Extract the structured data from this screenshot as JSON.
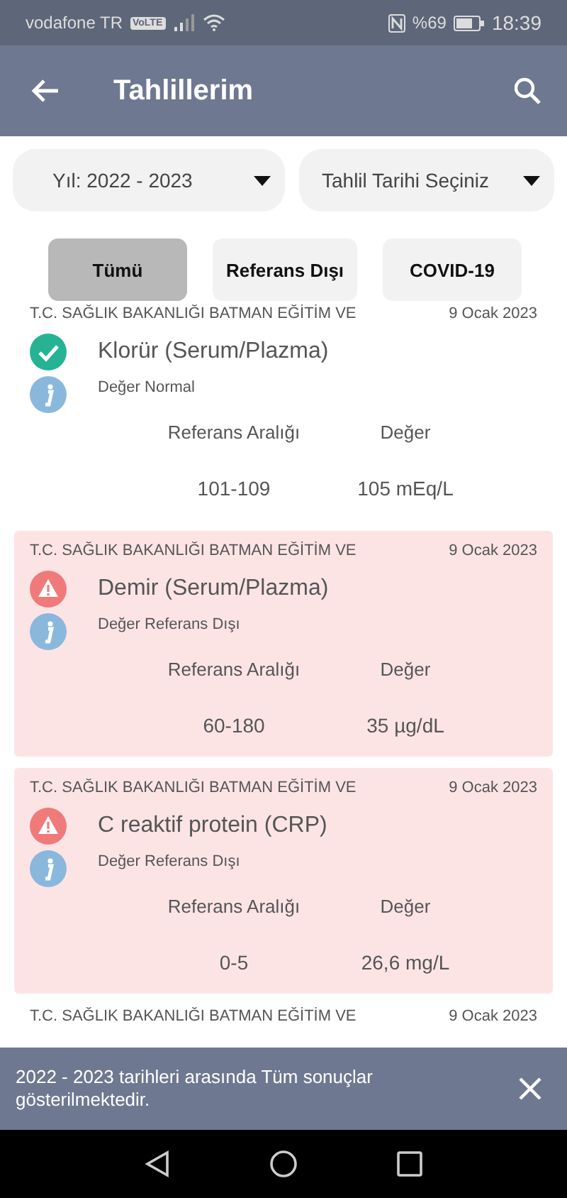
{
  "status_bar": {
    "carrier": "vodafone TR",
    "volte": "VoLTE",
    "battery": "%69",
    "time": "18:39"
  },
  "app_bar": {
    "title": "Tahlillerim"
  },
  "filters": [
    {
      "label": "Yıl: 2022 - 2023"
    },
    {
      "label": "Tahlil Tarihi Seçiniz"
    }
  ],
  "tabs": [
    {
      "label": "Tümü",
      "selected": true
    },
    {
      "label": "Referans Dışı",
      "selected": false
    },
    {
      "label": "COVID-19",
      "selected": false
    }
  ],
  "results": [
    {
      "hospital": "T.C. SAĞLIK BAKANLIĞI BATMAN EĞİTİM VE",
      "date": "9 Ocak 2023",
      "out_of_range": false,
      "name": "Klorür (Serum/Plazma)",
      "note": "Değer Normal",
      "range_label": "Referans Aralığı",
      "value_label": "Değer",
      "range": "101-109",
      "value": "105 mEq/L"
    },
    {
      "hospital": "T.C. SAĞLIK BAKANLIĞI BATMAN EĞİTİM VE",
      "date": "9 Ocak 2023",
      "out_of_range": true,
      "name": "Demir (Serum/Plazma)",
      "note": "Değer Referans Dışı",
      "range_label": "Referans Aralığı",
      "value_label": "Değer",
      "range": "60-180",
      "value": "35 µg/dL"
    },
    {
      "hospital": "T.C. SAĞLIK BAKANLIĞI BATMAN EĞİTİM VE",
      "date": "9 Ocak 2023",
      "out_of_range": true,
      "name": "C reaktif protein (CRP)",
      "note": "Değer Referans Dışı",
      "range_label": "Referans Aralığı",
      "value_label": "Değer",
      "range": "0-5",
      "value": "26,6 mg/L"
    },
    {
      "hospital": "T.C. SAĞLIK BAKANLIĞI BATMAN EĞİTİM VE",
      "date": "9 Ocak 2023",
      "out_of_range": false
    }
  ],
  "snackbar": {
    "message": "2022 - 2023 tarihleri arasında Tüm sonuçlar gösterilmektedir."
  }
}
